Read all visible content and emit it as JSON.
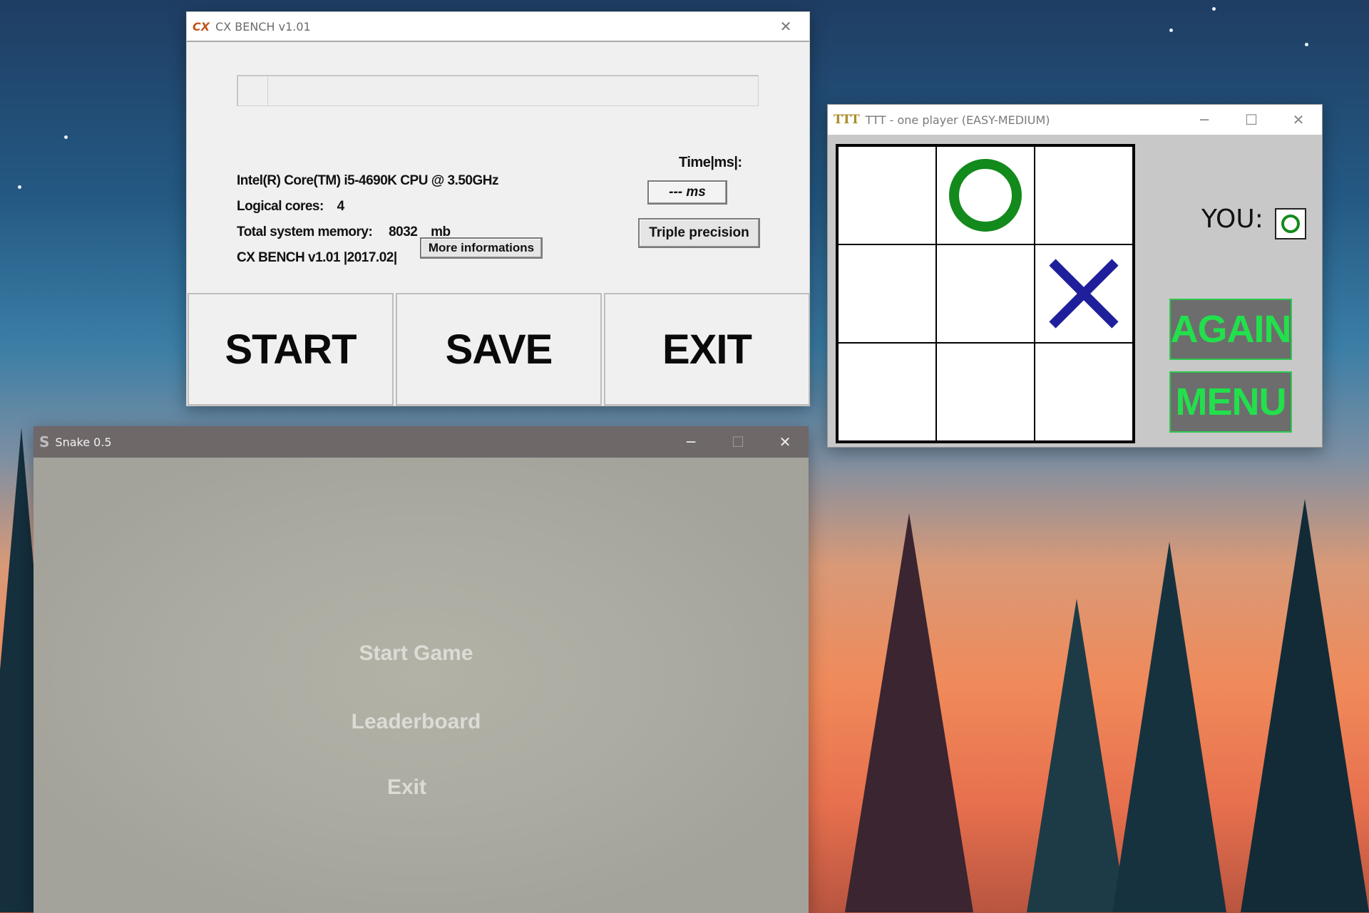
{
  "cx_bench": {
    "icon": "CX",
    "title": "CX BENCH v1.01",
    "cpu": "Intel(R) Core(TM) i5-4690K CPU @ 3.50GHz",
    "logical_cores_label": "Logical cores:",
    "logical_cores_value": "4",
    "memory_label": "Total system memory:",
    "memory_value": "8032",
    "memory_unit": "mb",
    "version_info": "CX BENCH v1.01 |2017.02|",
    "more_info_label": "More informations",
    "time_label": "Time|ms|:",
    "time_value": "--- ms",
    "triple_precision_label": "Triple precision",
    "start_label": "START",
    "save_label": "SAVE",
    "exit_label": "EXIT",
    "progress": 0.06
  },
  "ttt": {
    "icon": "TTT",
    "title": "TTT - one player (EASY-MEDIUM)",
    "board": [
      "",
      "O",
      "",
      "",
      "",
      "X",
      "",
      "",
      ""
    ],
    "you_label": "YOU:",
    "you_symbol": "O",
    "again_label": "AGAIN",
    "menu_label": "MENU",
    "colors": {
      "o": "#138a1c",
      "x": "#1f1f9c",
      "button_text": "#22e04c"
    }
  },
  "snake": {
    "title": "Snake 0.5",
    "menu": [
      "Start Game",
      "Leaderboard",
      "Exit"
    ]
  },
  "window_controls": {
    "minimize": "─",
    "maximize": "☐",
    "close": "✕"
  }
}
